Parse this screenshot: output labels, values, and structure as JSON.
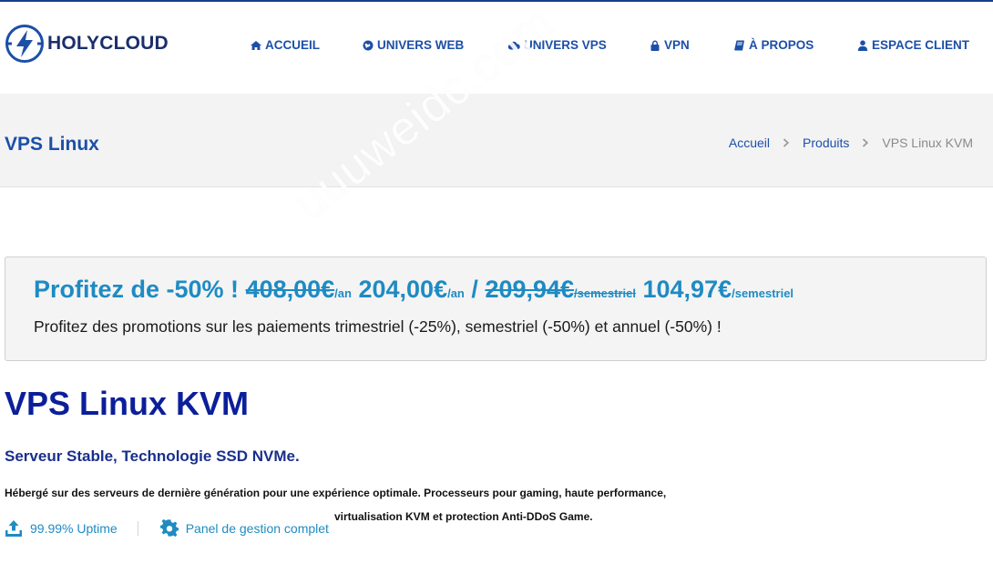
{
  "brand": {
    "name": "HOLYCLOUD"
  },
  "nav": {
    "items": [
      {
        "label": "ACCUEIL",
        "icon": "home-icon"
      },
      {
        "label": "UNIVERS WEB",
        "icon": "globe-icon"
      },
      {
        "label": "UNIVERS VPS",
        "icon": "cloud-icon"
      },
      {
        "label": "VPN",
        "icon": "lock-icon"
      },
      {
        "label": "À PROPOS",
        "icon": "book-icon"
      },
      {
        "label": "ESPACE CLIENT",
        "icon": "user-icon"
      }
    ]
  },
  "page": {
    "title": "VPS Linux",
    "breadcrumb": [
      "Accueil",
      "Produits",
      "VPS Linux KVM"
    ]
  },
  "watermark": "uuuweidc.com",
  "promo": {
    "lead": "Profitez de -50% !",
    "annual_old": "408,00€",
    "annual_old_unit": "/an",
    "annual_new": "204,00€",
    "annual_new_unit": "/an",
    "slash": "/",
    "semester_old": "209,94€",
    "semester_old_unit": "/semestriel",
    "semester_new": "104,97€",
    "semester_new_unit": "/semestriel",
    "subtitle": "Profitez des promotions sur les paiements trimestriel (-25%), semestriel (-50%) et annuel (-50%) !"
  },
  "product": {
    "title": "VPS Linux KVM",
    "subtitle": "Serveur Stable, Technologie SSD NVMe.",
    "description_line1": "Hébergé sur des serveurs de dernière génération pour une expérience optimale. Processeurs pour gaming, haute performance,",
    "description_line2": "virtualisation KVM et protection Anti-DDoS Game.",
    "features": [
      {
        "label": "99.99% Uptime",
        "icon": "upload-icon"
      },
      {
        "label": "Panel de gestion complet",
        "icon": "gear-icon"
      }
    ]
  },
  "colors": {
    "brand_dark": "#1a2f6b",
    "nav_blue": "#1c4fa8",
    "promo_blue": "#1e8bc3",
    "title_navy": "#0b1f9a"
  }
}
